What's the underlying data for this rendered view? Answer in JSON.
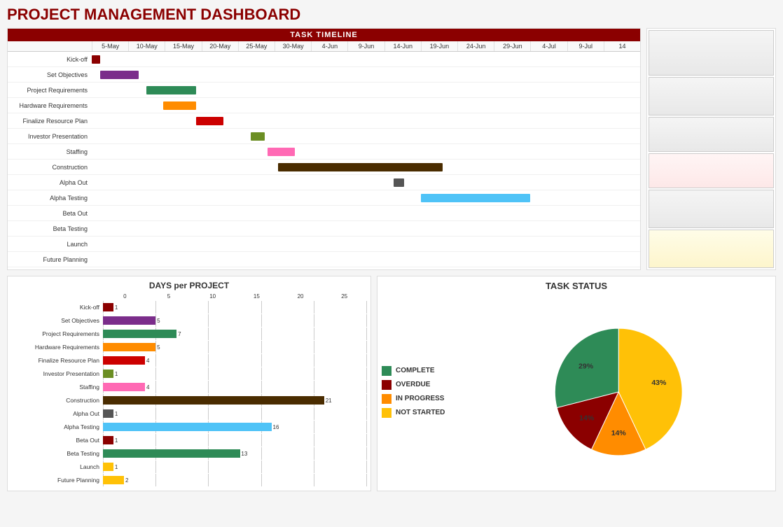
{
  "page": {
    "title": "PROJECT MANAGEMENT DASHBOARD"
  },
  "gantt": {
    "section_title": "TASK TIMELINE",
    "dates": [
      "5-May",
      "10-May",
      "15-May",
      "20-May",
      "25-May",
      "30-May",
      "4-Jun",
      "9-Jun",
      "14-Jun",
      "19-Jun",
      "24-Jun",
      "29-Jun",
      "4-Jul",
      "9-Jul",
      "14"
    ],
    "rows": [
      {
        "label": "Kick-off",
        "color": "#8B0000",
        "left_pct": 0,
        "width_pct": 1.5
      },
      {
        "label": "Set Objectives",
        "color": "#7B2D8B",
        "left_pct": 1.5,
        "width_pct": 7
      },
      {
        "label": "Project Requirements",
        "color": "#2E8B57",
        "left_pct": 10,
        "width_pct": 9
      },
      {
        "label": "Hardware Requirements",
        "color": "#FF8C00",
        "left_pct": 13,
        "width_pct": 6
      },
      {
        "label": "Finalize Resource Plan",
        "color": "#CC0000",
        "left_pct": 19,
        "width_pct": 5
      },
      {
        "label": "Investor Presentation",
        "color": "#6B8E23",
        "left_pct": 29,
        "width_pct": 2.5
      },
      {
        "label": "Staffing",
        "color": "#FF69B4",
        "left_pct": 32,
        "width_pct": 5
      },
      {
        "label": "Construction",
        "color": "#4A2C00",
        "left_pct": 34,
        "width_pct": 30
      },
      {
        "label": "Alpha Out",
        "color": "#555555",
        "left_pct": 55,
        "width_pct": 2
      },
      {
        "label": "Alpha Testing",
        "color": "#4FC3F7",
        "left_pct": 60,
        "width_pct": 20
      },
      {
        "label": "Beta Out",
        "color": "#333333",
        "left_pct": 0,
        "width_pct": 0
      },
      {
        "label": "Beta Testing",
        "color": "#333333",
        "left_pct": 0,
        "width_pct": 0
      },
      {
        "label": "Launch",
        "color": "#333333",
        "left_pct": 0,
        "width_pct": 0
      },
      {
        "label": "Future Planning",
        "color": "#333333",
        "left_pct": 0,
        "width_pct": 0
      }
    ]
  },
  "days_chart": {
    "title": "DAYS per PROJECT",
    "max_value": 25,
    "x_labels": [
      "0",
      "5",
      "10",
      "15",
      "20",
      "25"
    ],
    "rows": [
      {
        "label": "Kick-off",
        "value": 1,
        "color": "#8B0000"
      },
      {
        "label": "Set Objectives",
        "value": 5,
        "color": "#7B2D8B"
      },
      {
        "label": "Project Requirements",
        "value": 7,
        "color": "#2E8B57"
      },
      {
        "label": "Hardware Requirements",
        "value": 5,
        "color": "#FF8C00"
      },
      {
        "label": "Finalize Resource Plan",
        "value": 4,
        "color": "#CC0000"
      },
      {
        "label": "Investor Presentation",
        "value": 1,
        "color": "#6B8E23"
      },
      {
        "label": "Staffing",
        "value": 4,
        "color": "#FF69B4"
      },
      {
        "label": "Construction",
        "value": 21,
        "color": "#4A2C00"
      },
      {
        "label": "Alpha Out",
        "value": 1,
        "color": "#555555"
      },
      {
        "label": "Alpha Testing",
        "value": 16,
        "color": "#4FC3F7"
      },
      {
        "label": "Beta Out",
        "value": 1,
        "color": "#8B0000"
      },
      {
        "label": "Beta Testing",
        "value": 13,
        "color": "#2E8B57"
      },
      {
        "label": "Launch",
        "value": 1,
        "color": "#FFC107"
      },
      {
        "label": "Future Planning",
        "value": 2,
        "color": "#FFC107"
      }
    ]
  },
  "task_status": {
    "title": "TASK STATUS",
    "legend": [
      {
        "label": "COMPLETE",
        "color": "#2E8B57"
      },
      {
        "label": "OVERDUE",
        "color": "#8B0000"
      },
      {
        "label": "IN PROGRESS",
        "color": "#FF8C00"
      },
      {
        "label": "NOT STARTED",
        "color": "#FFC107"
      }
    ],
    "pie_slices": [
      {
        "label": "43%",
        "value": 43,
        "color": "#FFC107",
        "start_angle": 0,
        "end_angle": 154.8
      },
      {
        "label": "14%",
        "value": 14,
        "color": "#FF8C00",
        "start_angle": 154.8,
        "end_angle": 205.2
      },
      {
        "label": "14%",
        "value": 14,
        "color": "#8B0000",
        "start_angle": 205.2,
        "end_angle": 255.6
      },
      {
        "label": "29%",
        "value": 29,
        "color": "#2E8B57",
        "start_angle": 255.6,
        "end_angle": 360
      }
    ]
  }
}
